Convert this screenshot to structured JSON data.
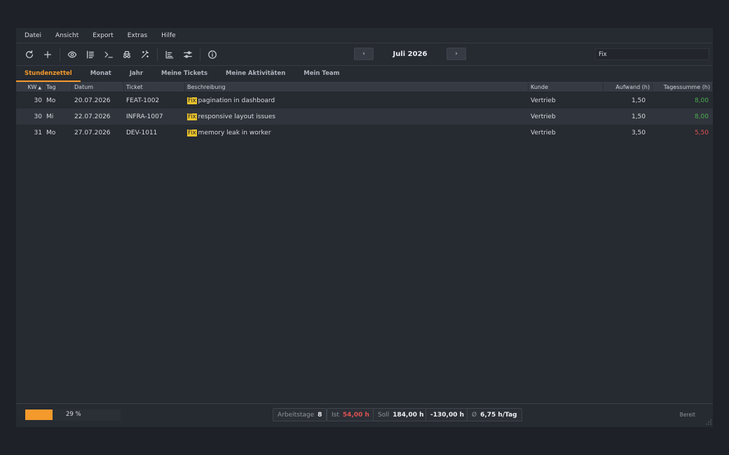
{
  "menu": [
    "Datei",
    "Ansicht",
    "Export",
    "Extras",
    "Hilfe"
  ],
  "toolbar": {
    "icons": [
      "refresh-icon",
      "plus-icon",
      "eye-icon",
      "list-icon",
      "terminal-icon",
      "spy-icon",
      "magic-icon",
      "gantt-icon",
      "sliders-icon",
      "info-icon"
    ],
    "prev_label": "‹",
    "next_label": "›",
    "period": "Juli 2026",
    "filter_value": "Fix"
  },
  "tabs": [
    "Stundenzettel",
    "Monat",
    "Jahr",
    "Meine Tickets",
    "Meine Aktivitäten",
    "Mein Team"
  ],
  "active_tab": "Stundenzettel",
  "table": {
    "columns": [
      "KW",
      "Tag",
      "Datum",
      "Ticket",
      "Beschreibung",
      "Kunde",
      "Aufwand (h)",
      "Tagessumme (h)"
    ],
    "sort_indicator": "▲",
    "rows": [
      {
        "kw": "30",
        "tag": "Mo",
        "datum": "20.07.2026",
        "ticket": "FEAT-1002",
        "tag_label": "Fix",
        "desc": "pagination in dashboard",
        "kunde": "Vertrieb",
        "aufwand": "1,50",
        "summe": "8,00",
        "summe_status": "green"
      },
      {
        "kw": "30",
        "tag": "Mi",
        "datum": "22.07.2026",
        "ticket": "INFRA-1007",
        "tag_label": "Fix",
        "desc": "responsive layout issues",
        "kunde": "Vertrieb",
        "aufwand": "1,50",
        "summe": "8,00",
        "summe_status": "green"
      },
      {
        "kw": "31",
        "tag": "Mo",
        "datum": "27.07.2026",
        "ticket": "DEV-1011",
        "tag_label": "Fix",
        "desc": "memory leak in worker",
        "kunde": "Vertrieb",
        "aufwand": "3,50",
        "summe": "5,50",
        "summe_status": "red"
      }
    ]
  },
  "status": {
    "progress_percent": 29,
    "progress_label": "29 %",
    "arbeitstage_label": "Arbeitstage",
    "arbeitstage_value": "8",
    "ist_label": "Ist",
    "ist_value": "54,00 h",
    "soll_label": "Soll",
    "soll_value": "184,00 h",
    "diff_value": "-130,00 h",
    "avg_label": "Ø",
    "avg_value": "6,75 h/Tag",
    "ready": "Bereit"
  },
  "colors": {
    "accent": "#f49a2c",
    "positive": "#4caf50",
    "negative": "#e05252",
    "tag_bg": "#e8c22b"
  }
}
